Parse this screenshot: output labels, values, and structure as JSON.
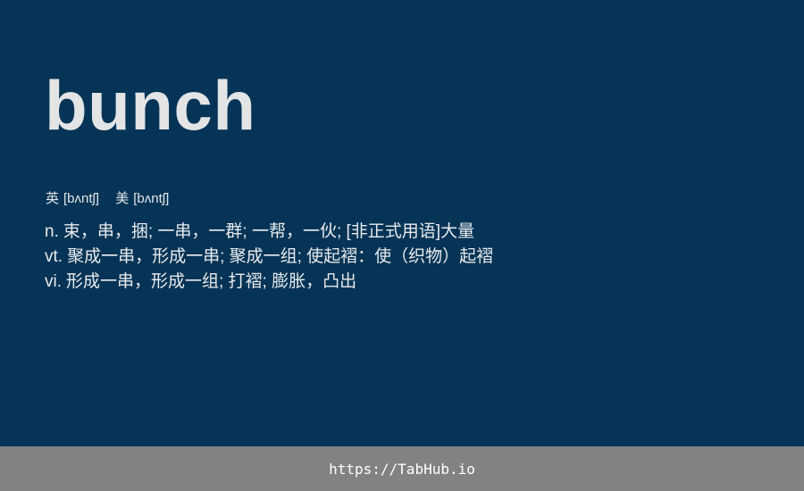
{
  "word": "bunch",
  "phonetics": [
    {
      "label": "英",
      "ipa": "[bʌntʃ]"
    },
    {
      "label": "美",
      "ipa": "[bʌntʃ]"
    }
  ],
  "definitions": [
    {
      "pos": "n.",
      "text": "束，串，捆; 一串，一群; 一帮，一伙; [非正式用语]大量"
    },
    {
      "pos": "vt.",
      "text": "聚成一串，形成一串; 聚成一组; 使起褶：使（织物）起褶"
    },
    {
      "pos": "vi.",
      "text": "形成一串，形成一组; 打褶; 膨胀，凸出"
    }
  ],
  "footer": {
    "link_text": "https://TabHub.io"
  },
  "colors": {
    "background": "#053456",
    "footer": "#838283",
    "word": "#e3e4e6"
  }
}
